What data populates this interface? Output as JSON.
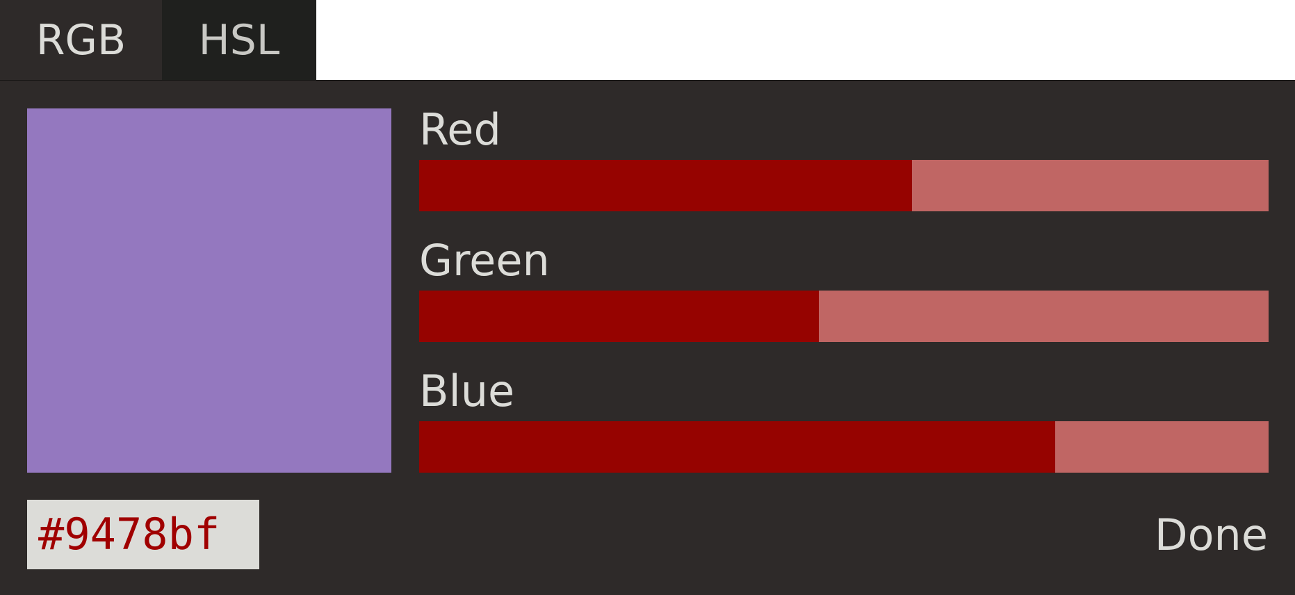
{
  "tabs": [
    {
      "label": "RGB",
      "active": true
    },
    {
      "label": "HSL",
      "active": false
    }
  ],
  "swatch": {
    "color": "#9478bf"
  },
  "sliders": [
    {
      "label": "Red",
      "value": 148,
      "max": 255
    },
    {
      "label": "Green",
      "value": 120,
      "max": 255
    },
    {
      "label": "Blue",
      "value": 191,
      "max": 255
    }
  ],
  "hex": {
    "value": "#9478bf"
  },
  "done_label": "Done",
  "colors": {
    "slider_fill": "#960300",
    "slider_track": "#c06664",
    "panel_bg": "#2e2a29",
    "text": "#dcdcd8",
    "hex_text": "#a00000"
  }
}
